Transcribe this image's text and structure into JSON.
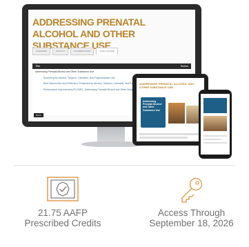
{
  "hero": {
    "screen_title": "ADDRESSING PRENATAL ALCOHOL AND OTHER SUBSTANCE USE",
    "tabs": [
      "OVERVIEW",
      "FACULTY",
      "ACCREDITATION",
      "TAKE COURSE"
    ],
    "table_header_left": "Title",
    "table_header_right": "Status",
    "rows": [
      "Addressing Prenatal Alcohol and Other Substance Use",
      "Screening for Alcohol, Tobacco, Cannabis, and Polysubstance Use",
      "Brief Intervention and Referral to Treatment for Alcohol, Tobacco, Cannabis, and Polysubstance Use",
      "Performance Improvement (PI-CME) - Addressing Prenatal Alcohol and Other Substance Use"
    ],
    "button_label": "BACK",
    "tablet_title": "ADDRESSING PRENATAL ALCOHOL AND OTHER SUBSTANCE USE",
    "tablet_card_text": "Addressing Prenatal Alcohol and Other Substance Use"
  },
  "credits": {
    "line1": "21.75 AAFP",
    "line2": "Prescribed Credits",
    "icon": "certificate-icon"
  },
  "access": {
    "line1": "Access Through",
    "line2": "September 18, 2026",
    "icon": "key-icon"
  },
  "colors": {
    "accent": "#b8842a",
    "text_muted": "#707070",
    "icon_stroke": "#e3a25a"
  }
}
